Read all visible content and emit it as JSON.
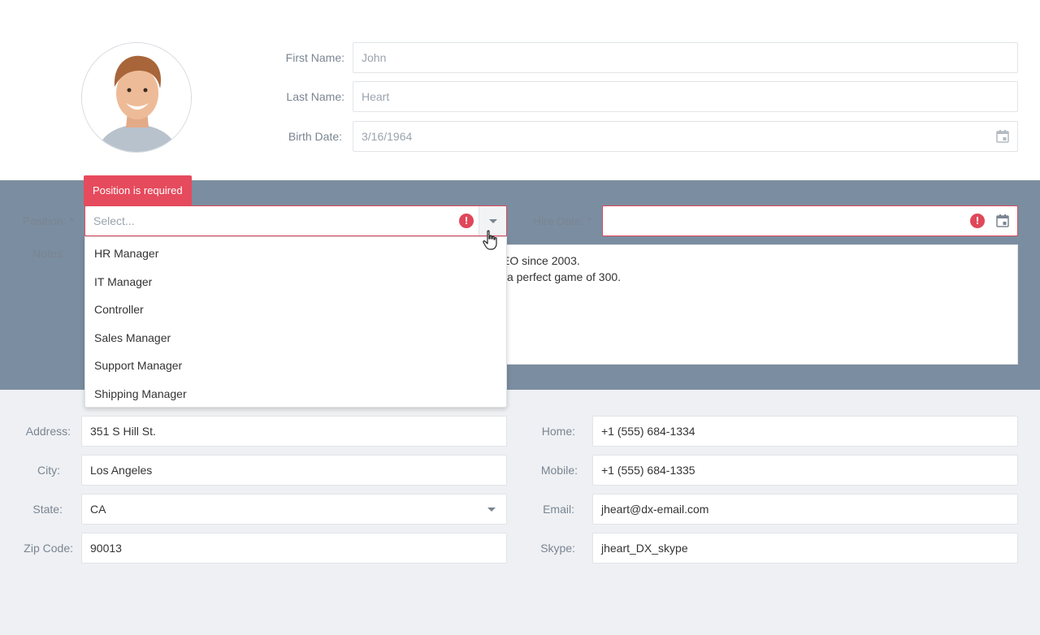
{
  "personal": {
    "first_name_label": "First Name:",
    "first_name_value": "John",
    "last_name_label": "Last Name:",
    "last_name_value": "Heart",
    "birth_date_label": "Birth Date:",
    "birth_date_value": "3/16/1964"
  },
  "job": {
    "position_label": "Position: *",
    "position_placeholder": "Select...",
    "position_error": "Position is required",
    "hire_date_label": "Hire Date: *",
    "hire_date_value": "",
    "notes_label": "Notes:",
    "notes_line1": "John has been in the Audio/Video industry since 1990. He has led DevAv as its CEO since 2003.",
    "notes_line2": "When not working hard as the CEO, John loves to golf and bowl. He once bowled a perfect game of 300."
  },
  "position_options": [
    "HR Manager",
    "IT Manager",
    "Controller",
    "Sales Manager",
    "Support Manager",
    "Shipping Manager"
  ],
  "address": {
    "address_label": "Address:",
    "address_value": "351 S Hill St.",
    "city_label": "City:",
    "city_value": "Los Angeles",
    "state_label": "State:",
    "state_value": "CA",
    "zip_label": "Zip Code:",
    "zip_value": "90013"
  },
  "contacts": {
    "home_label": "Home:",
    "home_value": "+1 (555) 684-1334",
    "mobile_label": "Mobile:",
    "mobile_value": "+1 (555) 684-1335",
    "email_label": "Email:",
    "email_value": "jheart@dx-email.com",
    "skype_label": "Skype:",
    "skype_value": "jheart_DX_skype"
  },
  "colors": {
    "error": "#e0475a",
    "panel": "#7b8da0",
    "bottom_bg": "#eef0f3"
  }
}
